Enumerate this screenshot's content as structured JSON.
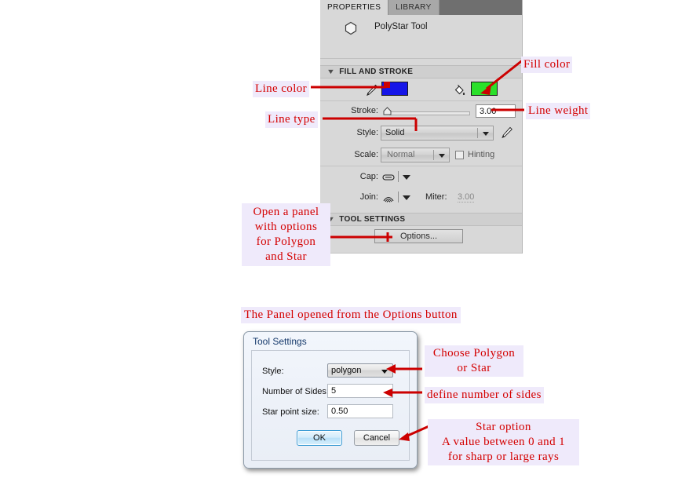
{
  "panel": {
    "tabs": [
      {
        "label": "PROPERTIES",
        "active": true
      },
      {
        "label": "LIBRARY",
        "active": false
      }
    ],
    "tool": {
      "icon": "polystar-icon",
      "name": "PolyStar Tool"
    },
    "sections": {
      "fill_and_stroke": "FILL AND STROKE",
      "tool_settings": "TOOL SETTINGS"
    },
    "fill_stroke": {
      "stroke_color": "#1515E8",
      "fill_color": "#2AE02A",
      "stroke_label": "Stroke:",
      "stroke_value": "3.00",
      "style_label": "Style:",
      "style_value": "Solid",
      "scale_label": "Scale:",
      "scale_value": "Normal",
      "hinting_label": "Hinting",
      "hinting_checked": false,
      "cap_label": "Cap:",
      "join_label": "Join:",
      "miter_label": "Miter:",
      "miter_value": "3.00"
    },
    "tool_settings": {
      "options_button": "Options..."
    }
  },
  "dialog": {
    "title": "Tool Settings",
    "style_label": "Style:",
    "style_value": "polygon",
    "sides_label": "Number of Sides:",
    "sides_value": "5",
    "starpoint_label": "Star point size:",
    "starpoint_value": "0.50",
    "ok_label": "OK",
    "cancel_label": "Cancel"
  },
  "annotations": {
    "line_color": "Line color",
    "line_type": "Line type",
    "fill_color": "Fill color",
    "line_weight": "Line weight",
    "options": "Open a panel\nwith options\nfor Polygon\nand Star",
    "panel_opened": "The Panel opened from the Options button",
    "choose_polygon": "Choose Polygon\nor Star",
    "define_sides": "define number of sides",
    "star_option": "Star option\nA value between 0 and 1\nfor sharp or large rays",
    "color": "#D40000",
    "highlight_bg": "#EFEAFB"
  }
}
